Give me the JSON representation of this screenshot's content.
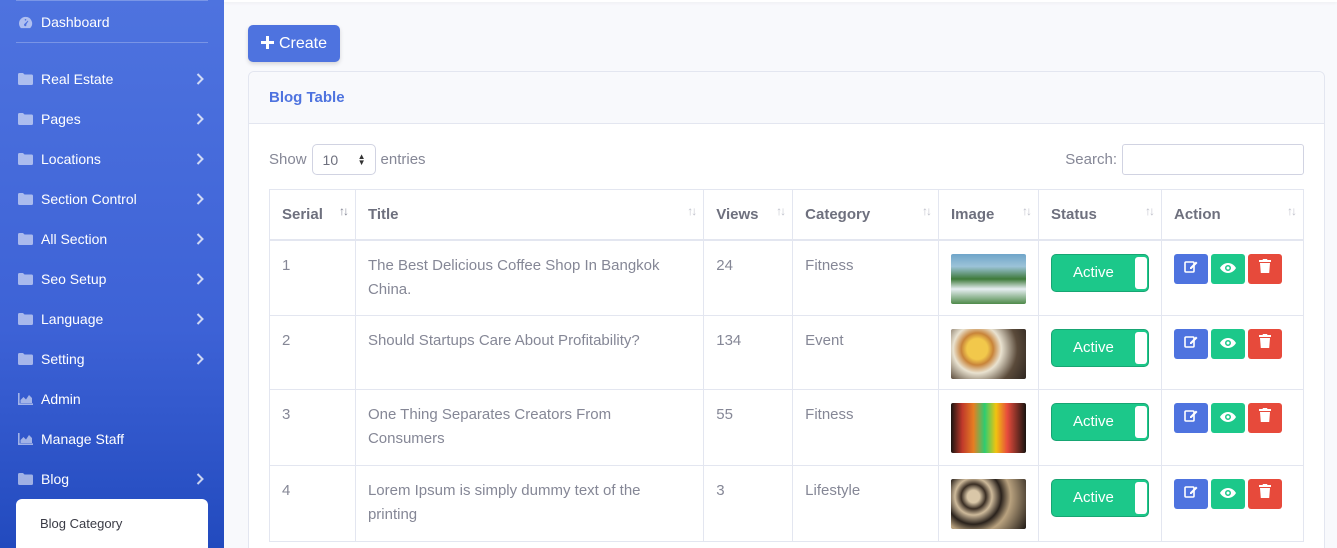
{
  "sidebar": {
    "dashboard": "Dashboard",
    "items": [
      {
        "label": "Real Estate",
        "icon": "folder-icon"
      },
      {
        "label": "Pages",
        "icon": "folder-icon"
      },
      {
        "label": "Locations",
        "icon": "folder-icon"
      },
      {
        "label": "Section Control",
        "icon": "folder-icon"
      },
      {
        "label": "All Section",
        "icon": "folder-icon"
      },
      {
        "label": "Seo Setup",
        "icon": "folder-icon"
      },
      {
        "label": "Language",
        "icon": "folder-icon"
      },
      {
        "label": "Setting",
        "icon": "folder-icon"
      },
      {
        "label": "Admin",
        "icon": "chart-area-icon"
      },
      {
        "label": "Manage Staff",
        "icon": "chart-area-icon"
      },
      {
        "label": "Blog",
        "icon": "folder-icon"
      }
    ],
    "sub_item": "Blog Category"
  },
  "toolbar": {
    "create_label": "Create"
  },
  "card": {
    "title": "Blog Table"
  },
  "controls": {
    "show_label": "Show",
    "entries_value": "10",
    "entries_label": "entries",
    "search_label": "Search:"
  },
  "table": {
    "columns": [
      "Serial",
      "Title",
      "Views",
      "Category",
      "Image",
      "Status",
      "Action"
    ],
    "rows": [
      {
        "serial": "1",
        "title": "The Best Delicious Coffee Shop In Bangkok China.",
        "views": "24",
        "category": "Fitness",
        "status": "Active"
      },
      {
        "serial": "2",
        "title": "Should Startups Care About Profitability?",
        "views": "134",
        "category": "Event",
        "status": "Active"
      },
      {
        "serial": "3",
        "title": "One Thing Separates Creators From Consumers",
        "views": "55",
        "category": "Fitness",
        "status": "Active"
      },
      {
        "serial": "4",
        "title": "Lorem Ipsum is simply dummy text of the printing",
        "views": "3",
        "category": "Lifestyle",
        "status": "Active"
      }
    ]
  },
  "colors": {
    "primary": "#4e73df",
    "success": "#1cc88a",
    "danger": "#e74a3b"
  }
}
